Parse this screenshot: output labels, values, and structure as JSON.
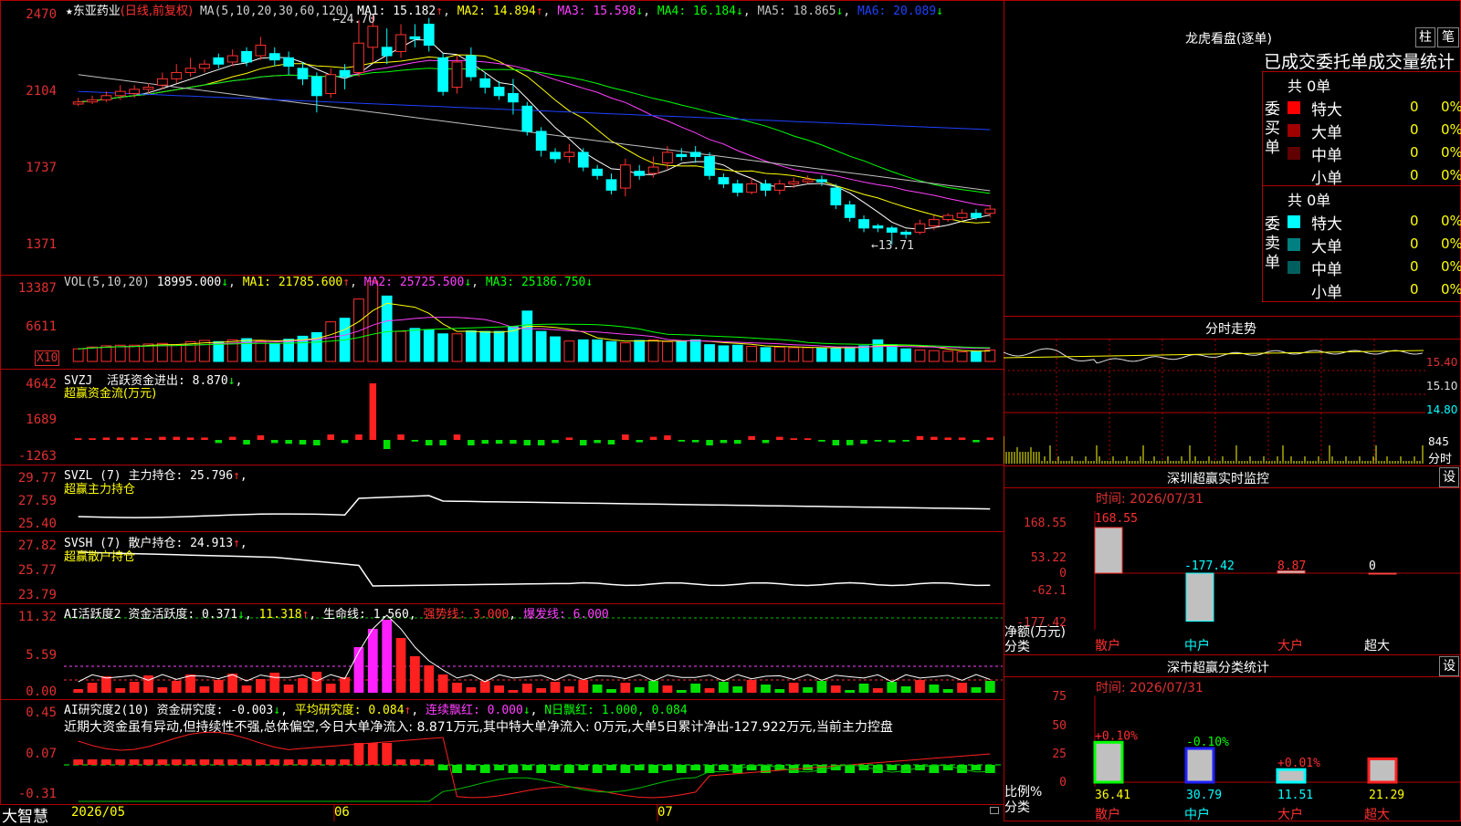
{
  "stock": {
    "star": "★",
    "name": "东亚药业",
    "period": "(日线,前复权)"
  },
  "main_ma": {
    "label": "MA(5,10,20,30,60,120)",
    "ma1": "MA1: 15.182",
    "ma2": "MA2: 14.894",
    "ma3": "MA3: 15.598",
    "ma4": "MA4: 16.184",
    "ma5": "MA5: 18.865",
    "ma6": "MA6: 20.089",
    "arrows": {
      "ma1": "↑",
      "ma2": "↑",
      "ma3": "↓",
      "ma4": "↓",
      "ma5": "↓",
      "ma6": "↓"
    },
    "colors": {
      "label": "#d0d0d0",
      "ma1": "#ffffff",
      "ma2": "#ffff00",
      "ma3": "#ff40ff",
      "ma4": "#00ff00",
      "ma5": "#c0c0c0",
      "ma6": "#2040ff"
    }
  },
  "main_axis": [
    "2470",
    "2104",
    "1737",
    "1371"
  ],
  "annot": {
    "high": "24.70",
    "low": "13.71"
  },
  "vol": {
    "label": "VOL(5,10,20)",
    "value": "18995.000",
    "ma1": "MA1: 21785.600",
    "ma2": "MA2: 25725.500",
    "ma3": "MA3: 25186.750",
    "axis": [
      "13387",
      "6611"
    ],
    "unit": "X10"
  },
  "svzj": {
    "name": "SVZJ",
    "title": "活跃资金进出: 8.870",
    "sub": "超赢资金流(万元)",
    "axis": [
      "4642",
      "1689",
      "-1263"
    ]
  },
  "svzl": {
    "name": "SVZL (7)",
    "title": "主力持仓: 25.796",
    "sub": "超赢主力持仓",
    "axis": [
      "29.77",
      "27.59",
      "25.40"
    ]
  },
  "svsh": {
    "name": "SVSH (7)",
    "title": "散户持仓: 24.913",
    "sub": "超赢散户持仓",
    "axis": [
      "27.82",
      "25.77",
      "23.79"
    ]
  },
  "ai2": {
    "name": "AI活跃度2",
    "title": "资金活跃度: 0.371",
    "v2": "11.318",
    "life": "生命线: 1.560",
    "strong": "强势线: 3.000",
    "burst": "爆发线: 6.000",
    "axis": [
      "11.32",
      "5.59",
      "0.00"
    ]
  },
  "ai_res": {
    "name": "AI研究度2(10)",
    "title": "资金研究度: -0.003",
    "avg": "平均研究度: 0.084",
    "lian": "连续飘红: 0.000",
    "nday": "N日飘红: 1.000, 0.084",
    "desc": "近期大资金虽有异动,但持续性不强,总体偏空,今日大单净流入: 8.871万元,其中特大单净流入: 0万元,大单5日累计净出-127.922万元,当前主力控盘",
    "axis": [
      "0.45",
      "0.07",
      "-0.31"
    ]
  },
  "bottom": {
    "brand": "大智慧",
    "dates": [
      "2026/05",
      "06",
      "07"
    ]
  },
  "lhkp": {
    "title": "龙虎看盘(逐单)",
    "btn1": "柱",
    "btn2": "笔",
    "heading": "已成交委托单成交量统计",
    "buy": {
      "label": [
        "委",
        "买",
        "单"
      ],
      "total": "共 0单",
      "rows": [
        {
          "name": "特大",
          "v": "0",
          "p": "0%",
          "color": "#ff0000"
        },
        {
          "name": "大单",
          "v": "0",
          "p": "0%",
          "color": "#a00000"
        },
        {
          "name": "中单",
          "v": "0",
          "p": "0%",
          "color": "#600000"
        },
        {
          "name": "小单",
          "v": "0",
          "p": "0%",
          "color": ""
        }
      ]
    },
    "sell": {
      "label": [
        "委",
        "卖",
        "单"
      ],
      "total": "共 0单",
      "rows": [
        {
          "name": "特大",
          "v": "0",
          "p": "0%",
          "color": "#00ffff"
        },
        {
          "name": "大单",
          "v": "0",
          "p": "0%",
          "color": "#008080"
        },
        {
          "name": "中单",
          "v": "0",
          "p": "0%",
          "color": "#006060"
        },
        {
          "name": "小单",
          "v": "0",
          "p": "0%",
          "color": ""
        }
      ]
    }
  },
  "fenshi": {
    "title": "分时走势",
    "axis": [
      "15.40",
      "15.10",
      "14.80"
    ],
    "vol": "845",
    "vol_unit": "分时"
  },
  "sz_monitor": {
    "title": "深圳超赢实时监控",
    "btn": "设",
    "time": "时间: 2026/07/31",
    "axis": [
      "168.55",
      "53.22",
      "0",
      "-62.1",
      "-177.42"
    ],
    "ylab": "净额(万元)",
    "xlab": "分类",
    "cats": [
      "散户",
      "中户",
      "大户",
      "超大"
    ],
    "values": [
      "168.55",
      "-177.42",
      "8.87",
      "0"
    ]
  },
  "sz_stat": {
    "title": "深市超赢分类统计",
    "btn": "设",
    "time": "时间: 2026/07/31",
    "axis": [
      "75",
      "50",
      "25",
      "0"
    ],
    "ylab": "比例%",
    "xlab": "分类",
    "cats": [
      "散户",
      "中户",
      "大户",
      "超大"
    ],
    "top": [
      "+0.10%",
      "-0.10%",
      "+0.01%",
      ""
    ],
    "bottom": [
      "36.41",
      "30.79",
      "11.51",
      "21.29"
    ]
  },
  "chart_data": {
    "type": "candlestick",
    "title": "东亚药业 (日线,前复权)",
    "ylim": [
      13.71,
      24.7
    ],
    "candles": [
      [
        20.4,
        20.5,
        20.3,
        20.7
      ],
      [
        20.5,
        20.6,
        20.4,
        20.8
      ],
      [
        20.6,
        20.8,
        20.5,
        21.0
      ],
      [
        20.8,
        21.0,
        20.6,
        21.3
      ],
      [
        20.9,
        21.1,
        20.7,
        21.3
      ],
      [
        21.1,
        21.2,
        20.9,
        21.4
      ],
      [
        21.3,
        21.6,
        21.1,
        21.9
      ],
      [
        21.6,
        21.9,
        21.4,
        22.3
      ],
      [
        21.9,
        22.1,
        21.7,
        22.6
      ],
      [
        22.1,
        22.3,
        21.9,
        22.5
      ],
      [
        22.6,
        22.3,
        22.1,
        22.8
      ],
      [
        22.4,
        22.7,
        22.2,
        23.0
      ],
      [
        22.9,
        22.4,
        22.2,
        23.1
      ],
      [
        22.7,
        23.2,
        22.5,
        23.6
      ],
      [
        22.8,
        22.5,
        22.2,
        23.1
      ],
      [
        22.6,
        22.2,
        21.8,
        22.9
      ],
      [
        22.1,
        21.6,
        21.3,
        22.4
      ],
      [
        21.7,
        20.8,
        20.0,
        21.9
      ],
      [
        20.9,
        21.8,
        20.7,
        22.1
      ],
      [
        22.0,
        21.7,
        21.1,
        22.3
      ],
      [
        21.9,
        23.3,
        21.7,
        24.4
      ],
      [
        23.1,
        24.1,
        22.4,
        24.7
      ],
      [
        23.1,
        22.7,
        22.3,
        24.0
      ],
      [
        22.9,
        23.7,
        22.6,
        24.2
      ],
      [
        23.6,
        23.5,
        23.1,
        24.2
      ],
      [
        24.2,
        23.2,
        22.9,
        24.5
      ],
      [
        22.6,
        21.0,
        20.8,
        22.8
      ],
      [
        21.2,
        22.4,
        20.9,
        22.7
      ],
      [
        22.7,
        21.7,
        21.5,
        23.1
      ],
      [
        21.6,
        21.2,
        20.9,
        21.9
      ],
      [
        21.2,
        20.8,
        20.6,
        21.5
      ],
      [
        20.9,
        20.5,
        19.9,
        21.6
      ],
      [
        20.3,
        19.1,
        18.9,
        20.5
      ],
      [
        19.1,
        18.2,
        17.9,
        19.3
      ],
      [
        18.1,
        17.8,
        17.6,
        18.3
      ],
      [
        17.9,
        18.1,
        17.6,
        18.5
      ],
      [
        18.1,
        17.4,
        17.2,
        18.3
      ],
      [
        17.3,
        17.0,
        16.8,
        17.5
      ],
      [
        16.8,
        16.3,
        16.1,
        17.1
      ],
      [
        16.4,
        17.5,
        16.0,
        17.8
      ],
      [
        17.2,
        17.0,
        16.8,
        17.5
      ],
      [
        17.1,
        17.4,
        16.9,
        17.9
      ],
      [
        17.6,
        18.1,
        17.3,
        18.4
      ],
      [
        18.0,
        17.9,
        17.7,
        18.3
      ],
      [
        18.1,
        17.9,
        17.6,
        18.4
      ],
      [
        17.9,
        17.0,
        16.8,
        18.1
      ],
      [
        16.9,
        16.6,
        16.4,
        17.1
      ],
      [
        16.6,
        16.2,
        16.0,
        16.8
      ],
      [
        16.2,
        16.6,
        16.1,
        16.9
      ],
      [
        16.6,
        16.3,
        16.0,
        16.8
      ],
      [
        16.3,
        16.6,
        16.1,
        16.8
      ],
      [
        16.6,
        16.7,
        16.4,
        16.9
      ],
      [
        16.7,
        16.8,
        16.6,
        17.0
      ],
      [
        16.8,
        16.7,
        16.5,
        17.0
      ],
      [
        16.4,
        15.6,
        15.4,
        16.6
      ],
      [
        15.6,
        15.0,
        14.8,
        15.8
      ],
      [
        14.9,
        14.5,
        14.3,
        15.1
      ],
      [
        14.6,
        14.5,
        14.3,
        14.7
      ],
      [
        14.5,
        14.3,
        13.71,
        14.6
      ],
      [
        14.3,
        14.2,
        14.0,
        14.4
      ],
      [
        14.3,
        14.7,
        14.2,
        14.9
      ],
      [
        14.6,
        14.9,
        14.4,
        15.1
      ],
      [
        14.9,
        15.1,
        14.8,
        15.2
      ],
      [
        15.0,
        15.2,
        14.9,
        15.4
      ],
      [
        15.2,
        15.0,
        14.9,
        15.4
      ],
      [
        15.2,
        15.4,
        15.0,
        15.6
      ]
    ],
    "volumes": [
      2.1,
      2.4,
      2.6,
      2.7,
      2.7,
      2.9,
      3.0,
      2.8,
      3.3,
      3.5,
      3.3,
      3.6,
      3.8,
      3.4,
      3.0,
      3.7,
      4.2,
      4.8,
      6.6,
      7.2,
      10.4,
      13.39,
      10.9,
      5.0,
      5.5,
      5.3,
      4.6,
      4.6,
      5.1,
      5.0,
      5.0,
      5.8,
      8.4,
      5.0,
      4.1,
      3.4,
      3.6,
      3.6,
      3.3,
      3.1,
      3.5,
      3.6,
      3.3,
      3.4,
      3.6,
      2.8,
      2.6,
      2.7,
      2.5,
      2.3,
      2.4,
      2.3,
      2.3,
      2.2,
      2.2,
      2.4,
      2.6,
      3.6,
      2.8,
      2.1,
      1.9,
      1.8,
      1.7,
      1.6,
      1.7,
      1.9
    ],
    "svzl_value": 25.796,
    "svsh_value": 24.913,
    "svzj_value": 8.87,
    "ai_activity": 0.371,
    "ai_research": -0.003
  }
}
